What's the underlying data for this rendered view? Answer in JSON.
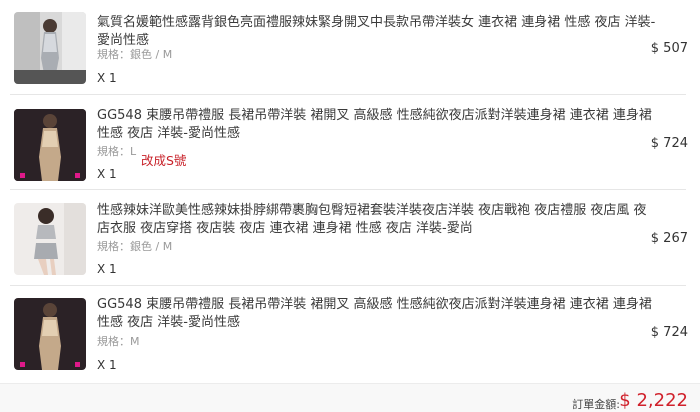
{
  "items": [
    {
      "title": "氣質名媛範性感露背銀色亮面禮服辣妹緊身開叉中長款吊帶洋裝女 連衣裙 連身裙 性感 夜店 洋裝-愛尚性感",
      "spec": "規格：銀色 / M",
      "note": "",
      "qty": "X 1",
      "price": "$ 507",
      "thumb_icon": "product-photo-silver-dress"
    },
    {
      "title": "GG548 束腰吊帶禮服 長裙吊帶洋裝 裙開叉 高級感 性感純欲夜店派對洋裝連身裙 連衣裙 連身裙 性感 夜店 洋裝-愛尚性感",
      "spec": "規格：L",
      "note": "改成S號",
      "qty": "X 1",
      "price": "$ 724",
      "thumb_icon": "product-photo-sequin-gown"
    },
    {
      "title": "性感辣妹洋歐美性感辣妹掛脖綁帶裹胸包臀短裙套裝洋裝夜店洋裝 夜店戰袍 夜店禮服 夜店風 夜店衣服 夜店穿搭 夜店裝 夜店 連衣裙 連身裙 性感 夜店 洋裝-愛尚",
      "spec": "規格：銀色 / M",
      "note": "",
      "qty": "X 1",
      "price": "$ 267",
      "thumb_icon": "product-photo-halter-set"
    },
    {
      "title": "GG548 束腰吊帶禮服 長裙吊帶洋裝 裙開叉 高級感 性感純欲夜店派對洋裝連身裙 連衣裙 連身裙 性感 夜店 洋裝-愛尚性感",
      "spec": "規格：M",
      "note": "",
      "qty": "X 1",
      "price": "$ 724",
      "thumb_icon": "product-photo-sequin-gown"
    }
  ],
  "footer": {
    "total_label": "訂單金額:",
    "total_value": "$ 2,222"
  },
  "colors": {
    "accent_red": "#d0212b",
    "muted_text": "#9a9a9a",
    "divider": "#e6e6e6"
  }
}
